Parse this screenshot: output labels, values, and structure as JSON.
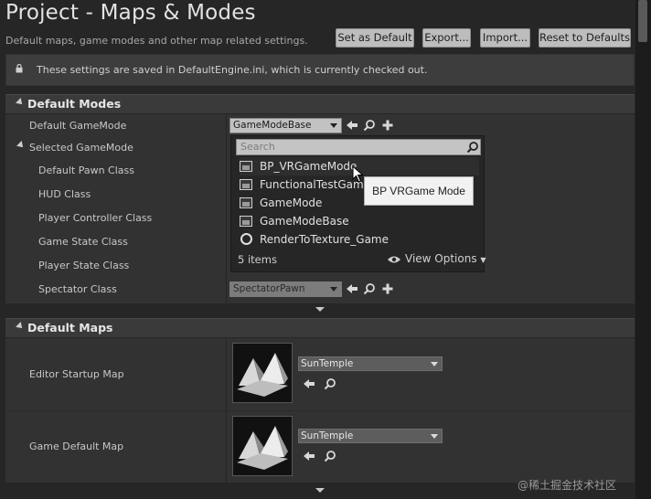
{
  "header": {
    "title": "Project - Maps & Modes",
    "subtitle": "Default maps, game modes and other map related settings.",
    "buttons": [
      "Set as Default",
      "Export...",
      "Import...",
      "Reset to Defaults"
    ]
  },
  "notice": {
    "text": "These settings are saved in DefaultEngine.ini, which is currently checked out."
  },
  "default_modes": {
    "section_title": "Default Modes",
    "default_gamemode_label": "Default GameMode",
    "default_gamemode_value": "GameModeBase",
    "selected_gamemode_label": "Selected GameMode",
    "rows": [
      "Default Pawn Class",
      "HUD Class",
      "Player Controller Class",
      "Game State Class",
      "Player State Class",
      "Spectator Class"
    ],
    "spectator_value": "SpectatorPawn"
  },
  "dropdown": {
    "search_placeholder": "Search",
    "items": [
      "BP_VRGameMode",
      "FunctionalTestGameMode",
      "GameMode",
      "GameModeBase",
      "RenderToTexture_Game"
    ],
    "count": "5 items",
    "view_options": "View Options",
    "tooltip": "BP VRGame Mode"
  },
  "default_maps": {
    "section_title": "Default Maps",
    "editor_startup_label": "Editor Startup Map",
    "editor_startup_value": "SunTemple",
    "game_default_label": "Game Default Map",
    "game_default_value": "SunTemple"
  },
  "watermark": "@稀土掘金技术社区",
  "colors": {
    "background": "#262626",
    "panel": "#323232",
    "header": "#3a3a3a",
    "tooltip": "#f2f2f2"
  }
}
